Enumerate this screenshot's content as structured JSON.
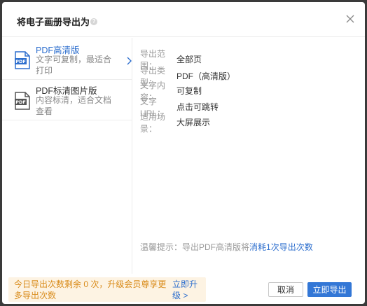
{
  "dialog": {
    "title": "将电子画册导出为",
    "help_icon": "question-circle-icon",
    "close_icon": "close-icon"
  },
  "options": [
    {
      "title": "PDF高清版",
      "description": "文字可复制，最适合打印",
      "icon": "pdf-file-icon",
      "icon_text": "PDF",
      "selected": true,
      "icon_color": "#2e6fce"
    },
    {
      "title": "PDF标清图片版",
      "description": "内容标清，适合文档查看",
      "icon": "pdf-file-icon",
      "icon_text": "PDF",
      "selected": false,
      "icon_color": "#555555"
    }
  ],
  "details": [
    {
      "label": "导出范围：",
      "value": "全部页"
    },
    {
      "label": "导出类型：",
      "value": "PDF（高清版）"
    },
    {
      "label": "文字内容：",
      "value": "可复制"
    },
    {
      "label": "文字URL：",
      "value": "点击可跳转"
    },
    {
      "label": "适用场景：",
      "value": "大屏展示"
    }
  ],
  "tip": {
    "prefix": "温馨提示：导出PDF高清版将",
    "highlight": "消耗1次导出次数"
  },
  "footer": {
    "notice": "今日导出次数剩余 0 次，升级会员尊享更多导出次数",
    "upgrade_link": "立即升级 >",
    "cancel_label": "取消",
    "export_label": "立即导出"
  },
  "colors": {
    "accent": "#3377d6",
    "link": "#2e6fce",
    "notice_text": "#d98b1a",
    "notice_bg": "#fdf3e3"
  }
}
